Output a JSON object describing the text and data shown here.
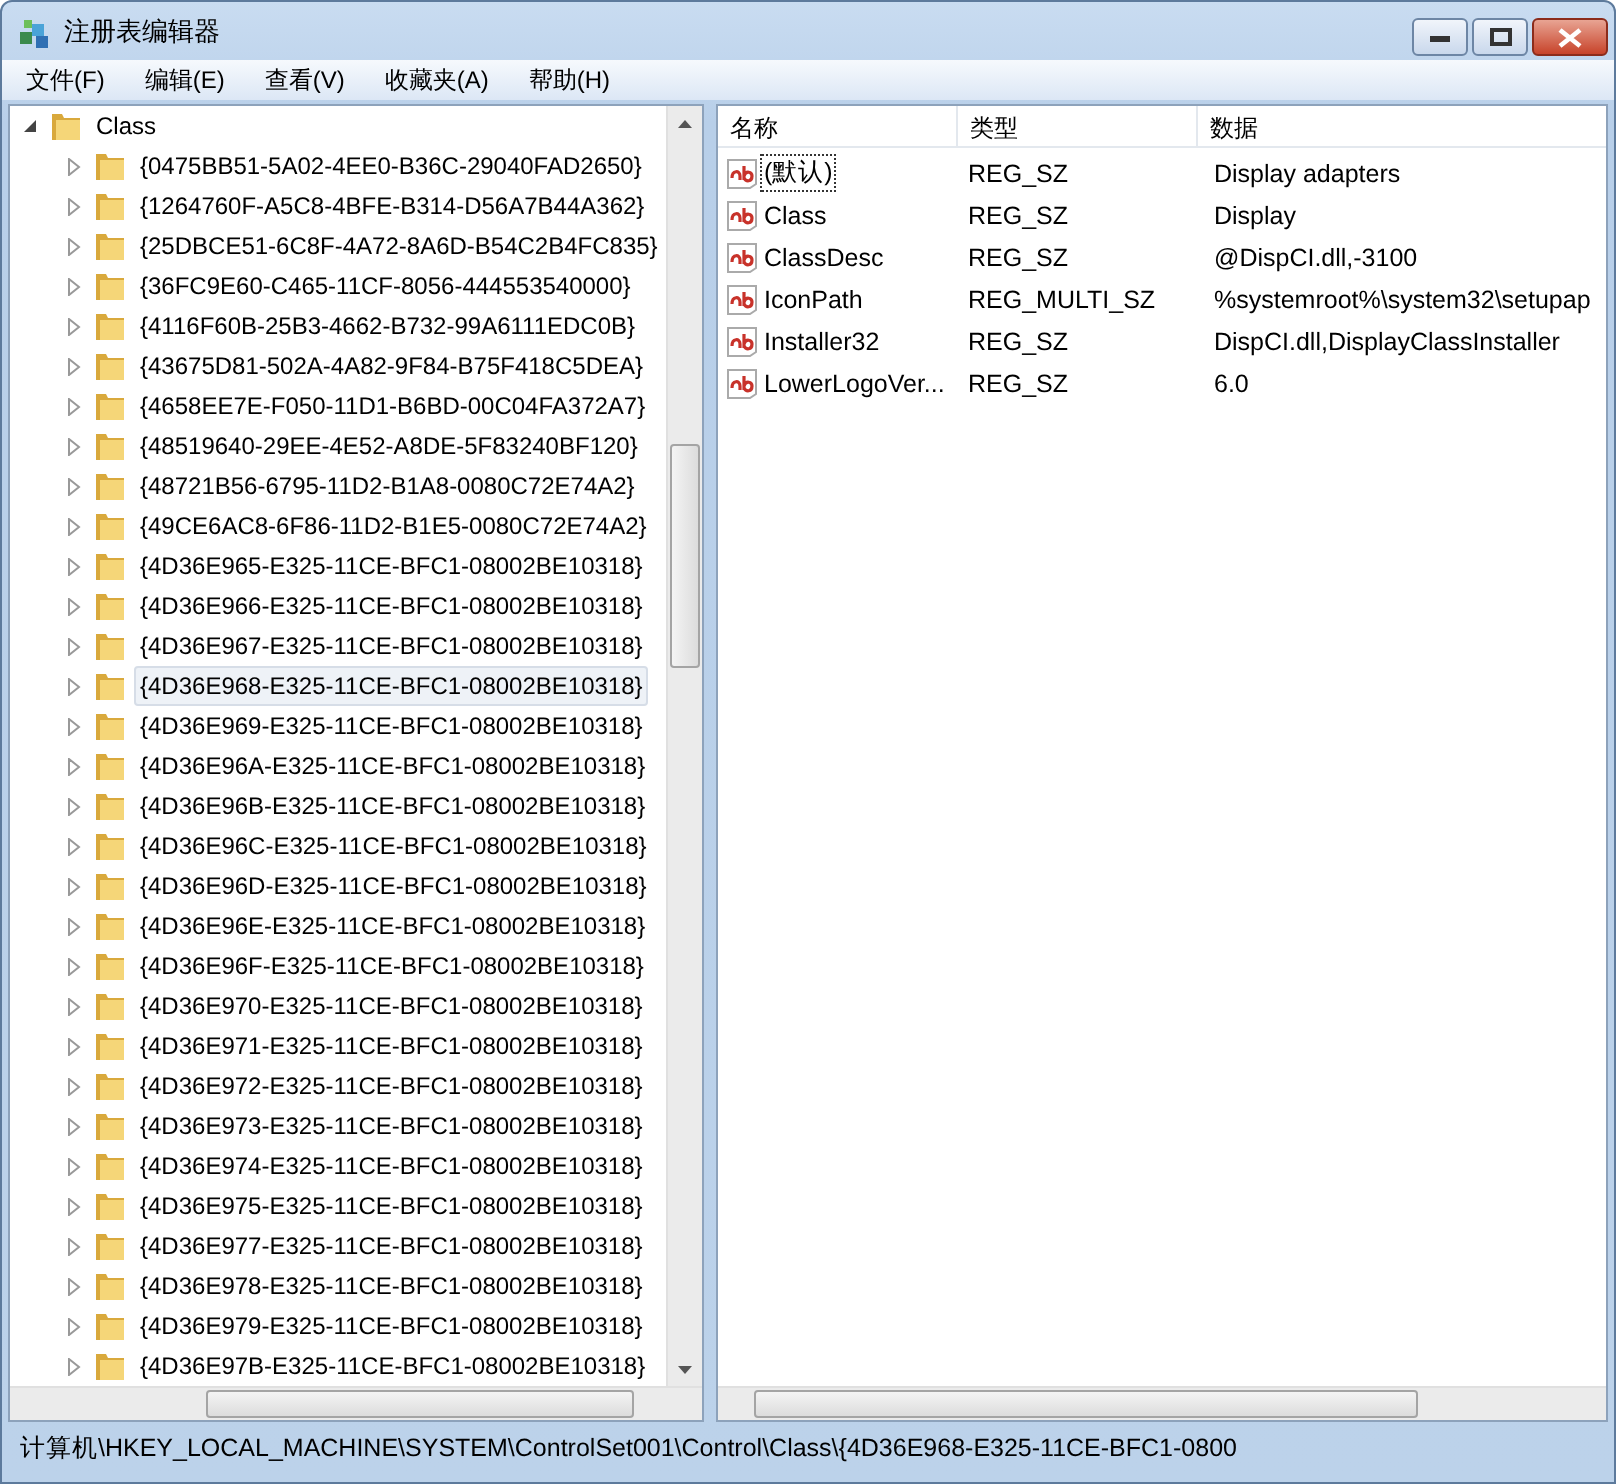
{
  "window": {
    "title": "注册表编辑器"
  },
  "menu": [
    {
      "label": "文件(F)"
    },
    {
      "label": "编辑(E)"
    },
    {
      "label": "查看(V)"
    },
    {
      "label": "收藏夹(A)"
    },
    {
      "label": "帮助(H)"
    }
  ],
  "tree": {
    "label": "Class",
    "expanded": true,
    "selected": false,
    "children": [
      {
        "label": "{0475BB51-5A02-4EE0-B36C-29040FAD2650}",
        "expanded": false,
        "selected": false
      },
      {
        "label": "{1264760F-A5C8-4BFE-B314-D56A7B44A362}",
        "expanded": false,
        "selected": false
      },
      {
        "label": "{25DBCE51-6C8F-4A72-8A6D-B54C2B4FC835}",
        "expanded": false,
        "selected": false
      },
      {
        "label": "{36FC9E60-C465-11CF-8056-444553540000}",
        "expanded": false,
        "selected": false
      },
      {
        "label": "{4116F60B-25B3-4662-B732-99A6111EDC0B}",
        "expanded": false,
        "selected": false
      },
      {
        "label": "{43675D81-502A-4A82-9F84-B75F418C5DEA}",
        "expanded": false,
        "selected": false
      },
      {
        "label": "{4658EE7E-F050-11D1-B6BD-00C04FA372A7}",
        "expanded": false,
        "selected": false
      },
      {
        "label": "{48519640-29EE-4E52-A8DE-5F83240BF120}",
        "expanded": false,
        "selected": false
      },
      {
        "label": "{48721B56-6795-11D2-B1A8-0080C72E74A2}",
        "expanded": false,
        "selected": false
      },
      {
        "label": "{49CE6AC8-6F86-11D2-B1E5-0080C72E74A2}",
        "expanded": false,
        "selected": false
      },
      {
        "label": "{4D36E965-E325-11CE-BFC1-08002BE10318}",
        "expanded": false,
        "selected": false
      },
      {
        "label": "{4D36E966-E325-11CE-BFC1-08002BE10318}",
        "expanded": false,
        "selected": false
      },
      {
        "label": "{4D36E967-E325-11CE-BFC1-08002BE10318}",
        "expanded": false,
        "selected": false
      },
      {
        "label": "{4D36E968-E325-11CE-BFC1-08002BE10318}",
        "expanded": false,
        "selected": true
      },
      {
        "label": "{4D36E969-E325-11CE-BFC1-08002BE10318}",
        "expanded": false,
        "selected": false
      },
      {
        "label": "{4D36E96A-E325-11CE-BFC1-08002BE10318}",
        "expanded": false,
        "selected": false
      },
      {
        "label": "{4D36E96B-E325-11CE-BFC1-08002BE10318}",
        "expanded": false,
        "selected": false
      },
      {
        "label": "{4D36E96C-E325-11CE-BFC1-08002BE10318}",
        "expanded": false,
        "selected": false
      },
      {
        "label": "{4D36E96D-E325-11CE-BFC1-08002BE10318}",
        "expanded": false,
        "selected": false
      },
      {
        "label": "{4D36E96E-E325-11CE-BFC1-08002BE10318}",
        "expanded": false,
        "selected": false
      },
      {
        "label": "{4D36E96F-E325-11CE-BFC1-08002BE10318}",
        "expanded": false,
        "selected": false
      },
      {
        "label": "{4D36E970-E325-11CE-BFC1-08002BE10318}",
        "expanded": false,
        "selected": false
      },
      {
        "label": "{4D36E971-E325-11CE-BFC1-08002BE10318}",
        "expanded": false,
        "selected": false
      },
      {
        "label": "{4D36E972-E325-11CE-BFC1-08002BE10318}",
        "expanded": false,
        "selected": false
      },
      {
        "label": "{4D36E973-E325-11CE-BFC1-08002BE10318}",
        "expanded": false,
        "selected": false
      },
      {
        "label": "{4D36E974-E325-11CE-BFC1-08002BE10318}",
        "expanded": false,
        "selected": false
      },
      {
        "label": "{4D36E975-E325-11CE-BFC1-08002BE10318}",
        "expanded": false,
        "selected": false
      },
      {
        "label": "{4D36E977-E325-11CE-BFC1-08002BE10318}",
        "expanded": false,
        "selected": false
      },
      {
        "label": "{4D36E978-E325-11CE-BFC1-08002BE10318}",
        "expanded": false,
        "selected": false
      },
      {
        "label": "{4D36E979-E325-11CE-BFC1-08002BE10318}",
        "expanded": false,
        "selected": false
      },
      {
        "label": "{4D36E97B-E325-11CE-BFC1-08002BE10318}",
        "expanded": false,
        "selected": false
      }
    ]
  },
  "values": {
    "columns": [
      "名称",
      "类型",
      "数据"
    ],
    "rows": [
      {
        "name": "(默认)",
        "type": "REG_SZ",
        "data": "Display adapters",
        "focused": true
      },
      {
        "name": "Class",
        "type": "REG_SZ",
        "data": "Display",
        "focused": false
      },
      {
        "name": "ClassDesc",
        "type": "REG_SZ",
        "data": "@DispCI.dll,-3100",
        "focused": false
      },
      {
        "name": "IconPath",
        "type": "REG_MULTI_SZ",
        "data": "%systemroot%\\system32\\setupap",
        "focused": false
      },
      {
        "name": "Installer32",
        "type": "REG_SZ",
        "data": "DispCI.dll,DisplayClassInstaller",
        "focused": false
      },
      {
        "name": "LowerLogoVer...",
        "type": "REG_SZ",
        "data": "6.0",
        "focused": false
      }
    ]
  },
  "status_bar": {
    "text": "计算机\\HKEY_LOCAL_MACHINE\\SYSTEM\\ControlSet001\\Control\\Class\\{4D36E968-E325-11CE-BFC1-0800"
  }
}
